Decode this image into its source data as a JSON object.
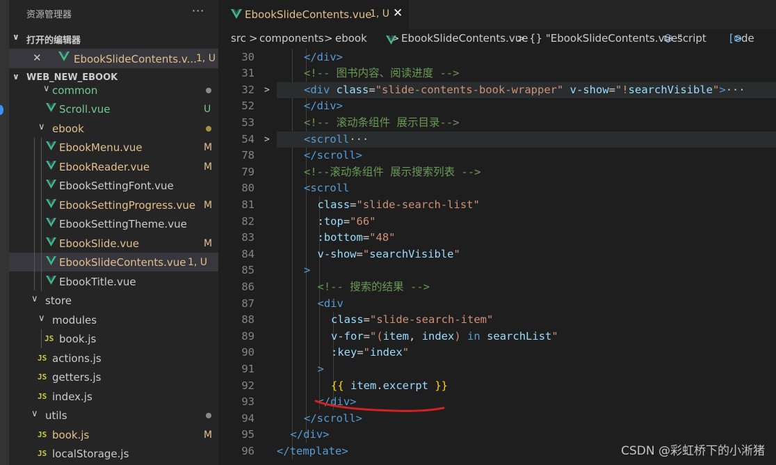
{
  "sidebar": {
    "title": "资源管理器",
    "more": "···",
    "open_editors": {
      "label": "打开的编辑器",
      "file": {
        "name": "EbookSlideContents.v...",
        "badge": "1, U"
      }
    },
    "workspace": {
      "label": "WEB_NEW_EBOOK",
      "rows": [
        {
          "name": "common",
          "kind": "folder",
          "badge": "",
          "dot": "#8a8a8a"
        },
        {
          "name": "Scroll.vue",
          "kind": "vue",
          "badge": "U"
        },
        {
          "name": "ebook",
          "kind": "folder",
          "badge": "",
          "dot": "#a39340"
        },
        {
          "name": "EbookMenu.vue",
          "kind": "vue",
          "badge": "M"
        },
        {
          "name": "EbookReader.vue",
          "kind": "vue",
          "badge": "M"
        },
        {
          "name": "EbookSettingFont.vue",
          "kind": "vue",
          "badge": ""
        },
        {
          "name": "EbookSettingProgress.vue",
          "kind": "vue",
          "badge": "M"
        },
        {
          "name": "EbookSettingTheme.vue",
          "kind": "vue",
          "badge": ""
        },
        {
          "name": "EbookSlide.vue",
          "kind": "vue",
          "badge": "M"
        },
        {
          "name": "EbookSlideContents.vue",
          "kind": "vue",
          "badge": "1, U"
        },
        {
          "name": "EbookTitle.vue",
          "kind": "vue",
          "badge": ""
        },
        {
          "name": "store",
          "kind": "folder",
          "badge": ""
        },
        {
          "name": "modules",
          "kind": "folder",
          "badge": ""
        },
        {
          "name": "book.js",
          "kind": "js",
          "badge": ""
        },
        {
          "name": "actions.js",
          "kind": "js",
          "badge": ""
        },
        {
          "name": "getters.js",
          "kind": "js",
          "badge": ""
        },
        {
          "name": "index.js",
          "kind": "js",
          "badge": ""
        },
        {
          "name": "utils",
          "kind": "folder",
          "badge": "",
          "dot": "#8a8a8a"
        },
        {
          "name": "book.js",
          "kind": "js",
          "badge": "M"
        },
        {
          "name": "localStorage.js",
          "kind": "js",
          "badge": ""
        }
      ]
    }
  },
  "tab": {
    "name": "EbookSlideContents.vue",
    "badge": "1, U",
    "close": "✕"
  },
  "breadcrumb": {
    "items": [
      "src",
      "components",
      "ebook",
      "EbookSlideContents.vue",
      "{} \"EbookSlideContents.vue\"",
      "script",
      "de"
    ],
    "sep": ">"
  },
  "editor": {
    "lines": [
      {
        "n": "30",
        "fold": "",
        "indent": 2,
        "hl": false,
        "tokens": [
          [
            "tag",
            "</div>"
          ]
        ]
      },
      {
        "n": "31",
        "fold": "",
        "indent": 2,
        "hl": false,
        "tokens": [
          [
            "cmt",
            "<!-- 图书内容、阅读进度 -->"
          ]
        ]
      },
      {
        "n": "32",
        "fold": ">",
        "indent": 2,
        "hl": true,
        "tokens": [
          [
            "tag",
            "<div "
          ],
          [
            "attr",
            "class"
          ],
          [
            "txt",
            "="
          ],
          [
            "str",
            "\"slide-contents-book-wrapper\""
          ],
          [
            "txt",
            " "
          ],
          [
            "attr",
            "v-show"
          ],
          [
            "txt",
            "="
          ],
          [
            "str",
            "\"!"
          ],
          [
            "attr",
            "searchVisible"
          ],
          [
            "str",
            "\""
          ],
          [
            "tag",
            ">"
          ],
          [
            "ell",
            "···"
          ]
        ]
      },
      {
        "n": "52",
        "fold": "",
        "indent": 2,
        "hl": false,
        "tokens": [
          [
            "tag",
            "</div>"
          ]
        ]
      },
      {
        "n": "53",
        "fold": "",
        "indent": 2,
        "hl": false,
        "tokens": [
          [
            "cmt",
            "<!-- 滚动条组件 展示目录-->"
          ]
        ]
      },
      {
        "n": "54",
        "fold": ">",
        "indent": 2,
        "hl": true,
        "tokens": [
          [
            "tag",
            "<scroll"
          ],
          [
            "ell",
            "···"
          ]
        ]
      },
      {
        "n": "78",
        "fold": "",
        "indent": 2,
        "hl": false,
        "tokens": [
          [
            "tag",
            "</scroll>"
          ]
        ]
      },
      {
        "n": "79",
        "fold": "",
        "indent": 2,
        "hl": false,
        "tokens": [
          [
            "cmt",
            "<!--滚动条组件 展示搜索列表 -->"
          ]
        ]
      },
      {
        "n": "80",
        "fold": "",
        "indent": 2,
        "hl": false,
        "tokens": [
          [
            "tag",
            "<scroll"
          ]
        ]
      },
      {
        "n": "81",
        "fold": "",
        "indent": 3,
        "hl": false,
        "tokens": [
          [
            "attr",
            "class"
          ],
          [
            "txt",
            "="
          ],
          [
            "str",
            "\"slide-search-list\""
          ]
        ]
      },
      {
        "n": "82",
        "fold": "",
        "indent": 3,
        "hl": false,
        "tokens": [
          [
            "attr",
            ":top"
          ],
          [
            "txt",
            "="
          ],
          [
            "str",
            "\"66\""
          ]
        ]
      },
      {
        "n": "83",
        "fold": "",
        "indent": 3,
        "hl": false,
        "tokens": [
          [
            "attr",
            ":bottom"
          ],
          [
            "txt",
            "="
          ],
          [
            "str",
            "\"48\""
          ]
        ]
      },
      {
        "n": "84",
        "fold": "",
        "indent": 3,
        "hl": false,
        "tokens": [
          [
            "attr",
            "v-show"
          ],
          [
            "txt",
            "="
          ],
          [
            "str",
            "\""
          ],
          [
            "attr",
            "searchVisible"
          ],
          [
            "str",
            "\""
          ]
        ]
      },
      {
        "n": "85",
        "fold": "",
        "indent": 2,
        "hl": false,
        "tokens": [
          [
            "tag",
            ">"
          ]
        ]
      },
      {
        "n": "86",
        "fold": "",
        "indent": 3,
        "hl": false,
        "tokens": [
          [
            "cmt",
            "<!-- 搜索的结果 -->"
          ]
        ]
      },
      {
        "n": "87",
        "fold": "",
        "indent": 3,
        "hl": false,
        "tokens": [
          [
            "tag",
            "<div"
          ]
        ]
      },
      {
        "n": "88",
        "fold": "",
        "indent": 4,
        "hl": false,
        "tokens": [
          [
            "attr",
            "class"
          ],
          [
            "txt",
            "="
          ],
          [
            "str",
            "\"slide-search-item\""
          ]
        ]
      },
      {
        "n": "89",
        "fold": "",
        "indent": 4,
        "hl": false,
        "tokens": [
          [
            "attr",
            "v-for"
          ],
          [
            "txt",
            "="
          ],
          [
            "str",
            "\"("
          ],
          [
            "attr",
            "item"
          ],
          [
            "txt",
            ", "
          ],
          [
            "attr",
            "index"
          ],
          [
            "str",
            ")"
          ],
          [
            "txt",
            " "
          ],
          [
            "kw",
            "in"
          ],
          [
            "txt",
            " "
          ],
          [
            "attr",
            "searchList"
          ],
          [
            "str",
            "\""
          ]
        ]
      },
      {
        "n": "90",
        "fold": "",
        "indent": 4,
        "hl": false,
        "tokens": [
          [
            "attr",
            ":key"
          ],
          [
            "txt",
            "="
          ],
          [
            "str",
            "\""
          ],
          [
            "attr",
            "index"
          ],
          [
            "str",
            "\""
          ]
        ]
      },
      {
        "n": "91",
        "fold": "",
        "indent": 3,
        "hl": false,
        "tokens": [
          [
            "tag",
            ">"
          ]
        ]
      },
      {
        "n": "92",
        "fold": "",
        "indent": 4,
        "hl": false,
        "tokens": [
          [
            "mus",
            "{{ "
          ],
          [
            "attr",
            "item"
          ],
          [
            "txt",
            "."
          ],
          [
            "attr",
            "excerpt"
          ],
          [
            "mus",
            " }}"
          ]
        ]
      },
      {
        "n": "93",
        "fold": "",
        "indent": 3,
        "hl": false,
        "tokens": [
          [
            "tag",
            "</div>"
          ]
        ]
      },
      {
        "n": "94",
        "fold": "",
        "indent": 2,
        "hl": false,
        "tokens": [
          [
            "tag",
            "</scroll>"
          ]
        ]
      },
      {
        "n": "95",
        "fold": "",
        "indent": 1,
        "hl": false,
        "tokens": [
          [
            "tag",
            "</div>"
          ]
        ]
      },
      {
        "n": "96",
        "fold": "",
        "indent": 0,
        "hl": false,
        "tokens": [
          [
            "tag",
            "</template>"
          ]
        ]
      }
    ]
  },
  "watermark": "CSDN @彩虹桥下的小淅猪",
  "colors": {
    "modified": "#e2c08d",
    "untracked": "#73c991",
    "vue": "#41b883",
    "js": "#cbcb41"
  }
}
